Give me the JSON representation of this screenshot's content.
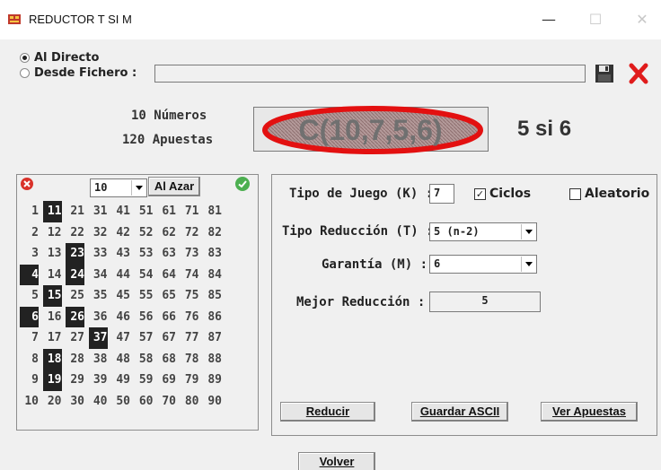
{
  "window": {
    "title": "REDUCTOR T SI M",
    "minimize": "—",
    "maximize": "☐",
    "close": "✕"
  },
  "source": {
    "direct_label": "Al Directo",
    "file_label": "Desde Fichero :",
    "file_value": ""
  },
  "stats": {
    "numbers": "10 Números",
    "bets": "120 Apuestas",
    "formula": "C(10,7,5,6)",
    "result": "5 si 6"
  },
  "selector": {
    "count": "10",
    "random_label": "Al Azar",
    "rows": [
      [
        {
          "n": "1",
          "s": false
        },
        {
          "n": "11",
          "s": true
        },
        {
          "n": "21",
          "s": false
        },
        {
          "n": "31",
          "s": false
        },
        {
          "n": "41",
          "s": false
        },
        {
          "n": "51",
          "s": false
        },
        {
          "n": "61",
          "s": false
        },
        {
          "n": "71",
          "s": false
        },
        {
          "n": "81",
          "s": false
        }
      ],
      [
        {
          "n": "2",
          "s": false
        },
        {
          "n": "12",
          "s": false
        },
        {
          "n": "22",
          "s": false
        },
        {
          "n": "32",
          "s": false
        },
        {
          "n": "42",
          "s": false
        },
        {
          "n": "52",
          "s": false
        },
        {
          "n": "62",
          "s": false
        },
        {
          "n": "72",
          "s": false
        },
        {
          "n": "82",
          "s": false
        }
      ],
      [
        {
          "n": "3",
          "s": false
        },
        {
          "n": "13",
          "s": false
        },
        {
          "n": "23",
          "s": true
        },
        {
          "n": "33",
          "s": false
        },
        {
          "n": "43",
          "s": false
        },
        {
          "n": "53",
          "s": false
        },
        {
          "n": "63",
          "s": false
        },
        {
          "n": "73",
          "s": false
        },
        {
          "n": "83",
          "s": false
        }
      ],
      [
        {
          "n": "4",
          "s": true
        },
        {
          "n": "14",
          "s": false
        },
        {
          "n": "24",
          "s": true
        },
        {
          "n": "34",
          "s": false
        },
        {
          "n": "44",
          "s": false
        },
        {
          "n": "54",
          "s": false
        },
        {
          "n": "64",
          "s": false
        },
        {
          "n": "74",
          "s": false
        },
        {
          "n": "84",
          "s": false
        }
      ],
      [
        {
          "n": "5",
          "s": false
        },
        {
          "n": "15",
          "s": true
        },
        {
          "n": "25",
          "s": false
        },
        {
          "n": "35",
          "s": false
        },
        {
          "n": "45",
          "s": false
        },
        {
          "n": "55",
          "s": false
        },
        {
          "n": "65",
          "s": false
        },
        {
          "n": "75",
          "s": false
        },
        {
          "n": "85",
          "s": false
        }
      ],
      [
        {
          "n": "6",
          "s": true
        },
        {
          "n": "16",
          "s": false
        },
        {
          "n": "26",
          "s": true
        },
        {
          "n": "36",
          "s": false
        },
        {
          "n": "46",
          "s": false
        },
        {
          "n": "56",
          "s": false
        },
        {
          "n": "66",
          "s": false
        },
        {
          "n": "76",
          "s": false
        },
        {
          "n": "86",
          "s": false
        }
      ],
      [
        {
          "n": "7",
          "s": false
        },
        {
          "n": "17",
          "s": false
        },
        {
          "n": "27",
          "s": false
        },
        {
          "n": "37",
          "s": true
        },
        {
          "n": "47",
          "s": false
        },
        {
          "n": "57",
          "s": false
        },
        {
          "n": "67",
          "s": false
        },
        {
          "n": "77",
          "s": false
        },
        {
          "n": "87",
          "s": false
        }
      ],
      [
        {
          "n": "8",
          "s": false
        },
        {
          "n": "18",
          "s": true
        },
        {
          "n": "28",
          "s": false
        },
        {
          "n": "38",
          "s": false
        },
        {
          "n": "48",
          "s": false
        },
        {
          "n": "58",
          "s": false
        },
        {
          "n": "68",
          "s": false
        },
        {
          "n": "78",
          "s": false
        },
        {
          "n": "88",
          "s": false
        }
      ],
      [
        {
          "n": "9",
          "s": false
        },
        {
          "n": "19",
          "s": true
        },
        {
          "n": "29",
          "s": false
        },
        {
          "n": "39",
          "s": false
        },
        {
          "n": "49",
          "s": false
        },
        {
          "n": "59",
          "s": false
        },
        {
          "n": "69",
          "s": false
        },
        {
          "n": "79",
          "s": false
        },
        {
          "n": "89",
          "s": false
        }
      ],
      [
        {
          "n": "10",
          "s": false
        },
        {
          "n": "20",
          "s": false
        },
        {
          "n": "30",
          "s": false
        },
        {
          "n": "40",
          "s": false
        },
        {
          "n": "50",
          "s": false
        },
        {
          "n": "60",
          "s": false
        },
        {
          "n": "70",
          "s": false
        },
        {
          "n": "80",
          "s": false
        },
        {
          "n": "90",
          "s": false
        }
      ]
    ]
  },
  "config": {
    "k_label": "Tipo de Juego (K) :",
    "k_value": "7",
    "ciclos_label": "Ciclos",
    "ciclos_checked": true,
    "aleatorio_label": "Aleatorio",
    "aleatorio_checked": false,
    "t_label": "Tipo Reducción (T) :",
    "t_value": "5 (n-2)",
    "m_label": "Garantía (M) :",
    "m_value": "6",
    "best_label": "Mejor Reducción :",
    "best_value": "5"
  },
  "buttons": {
    "reduce": "Reducir",
    "save_ascii": "Guardar ASCII",
    "view_bets": "Ver Apuestas",
    "back": "Volver"
  },
  "colors": {
    "selected_cell": "#222222",
    "delete_red": "#d9322a",
    "ok_green": "#4caf50",
    "ellipse_red": "#e31010"
  }
}
